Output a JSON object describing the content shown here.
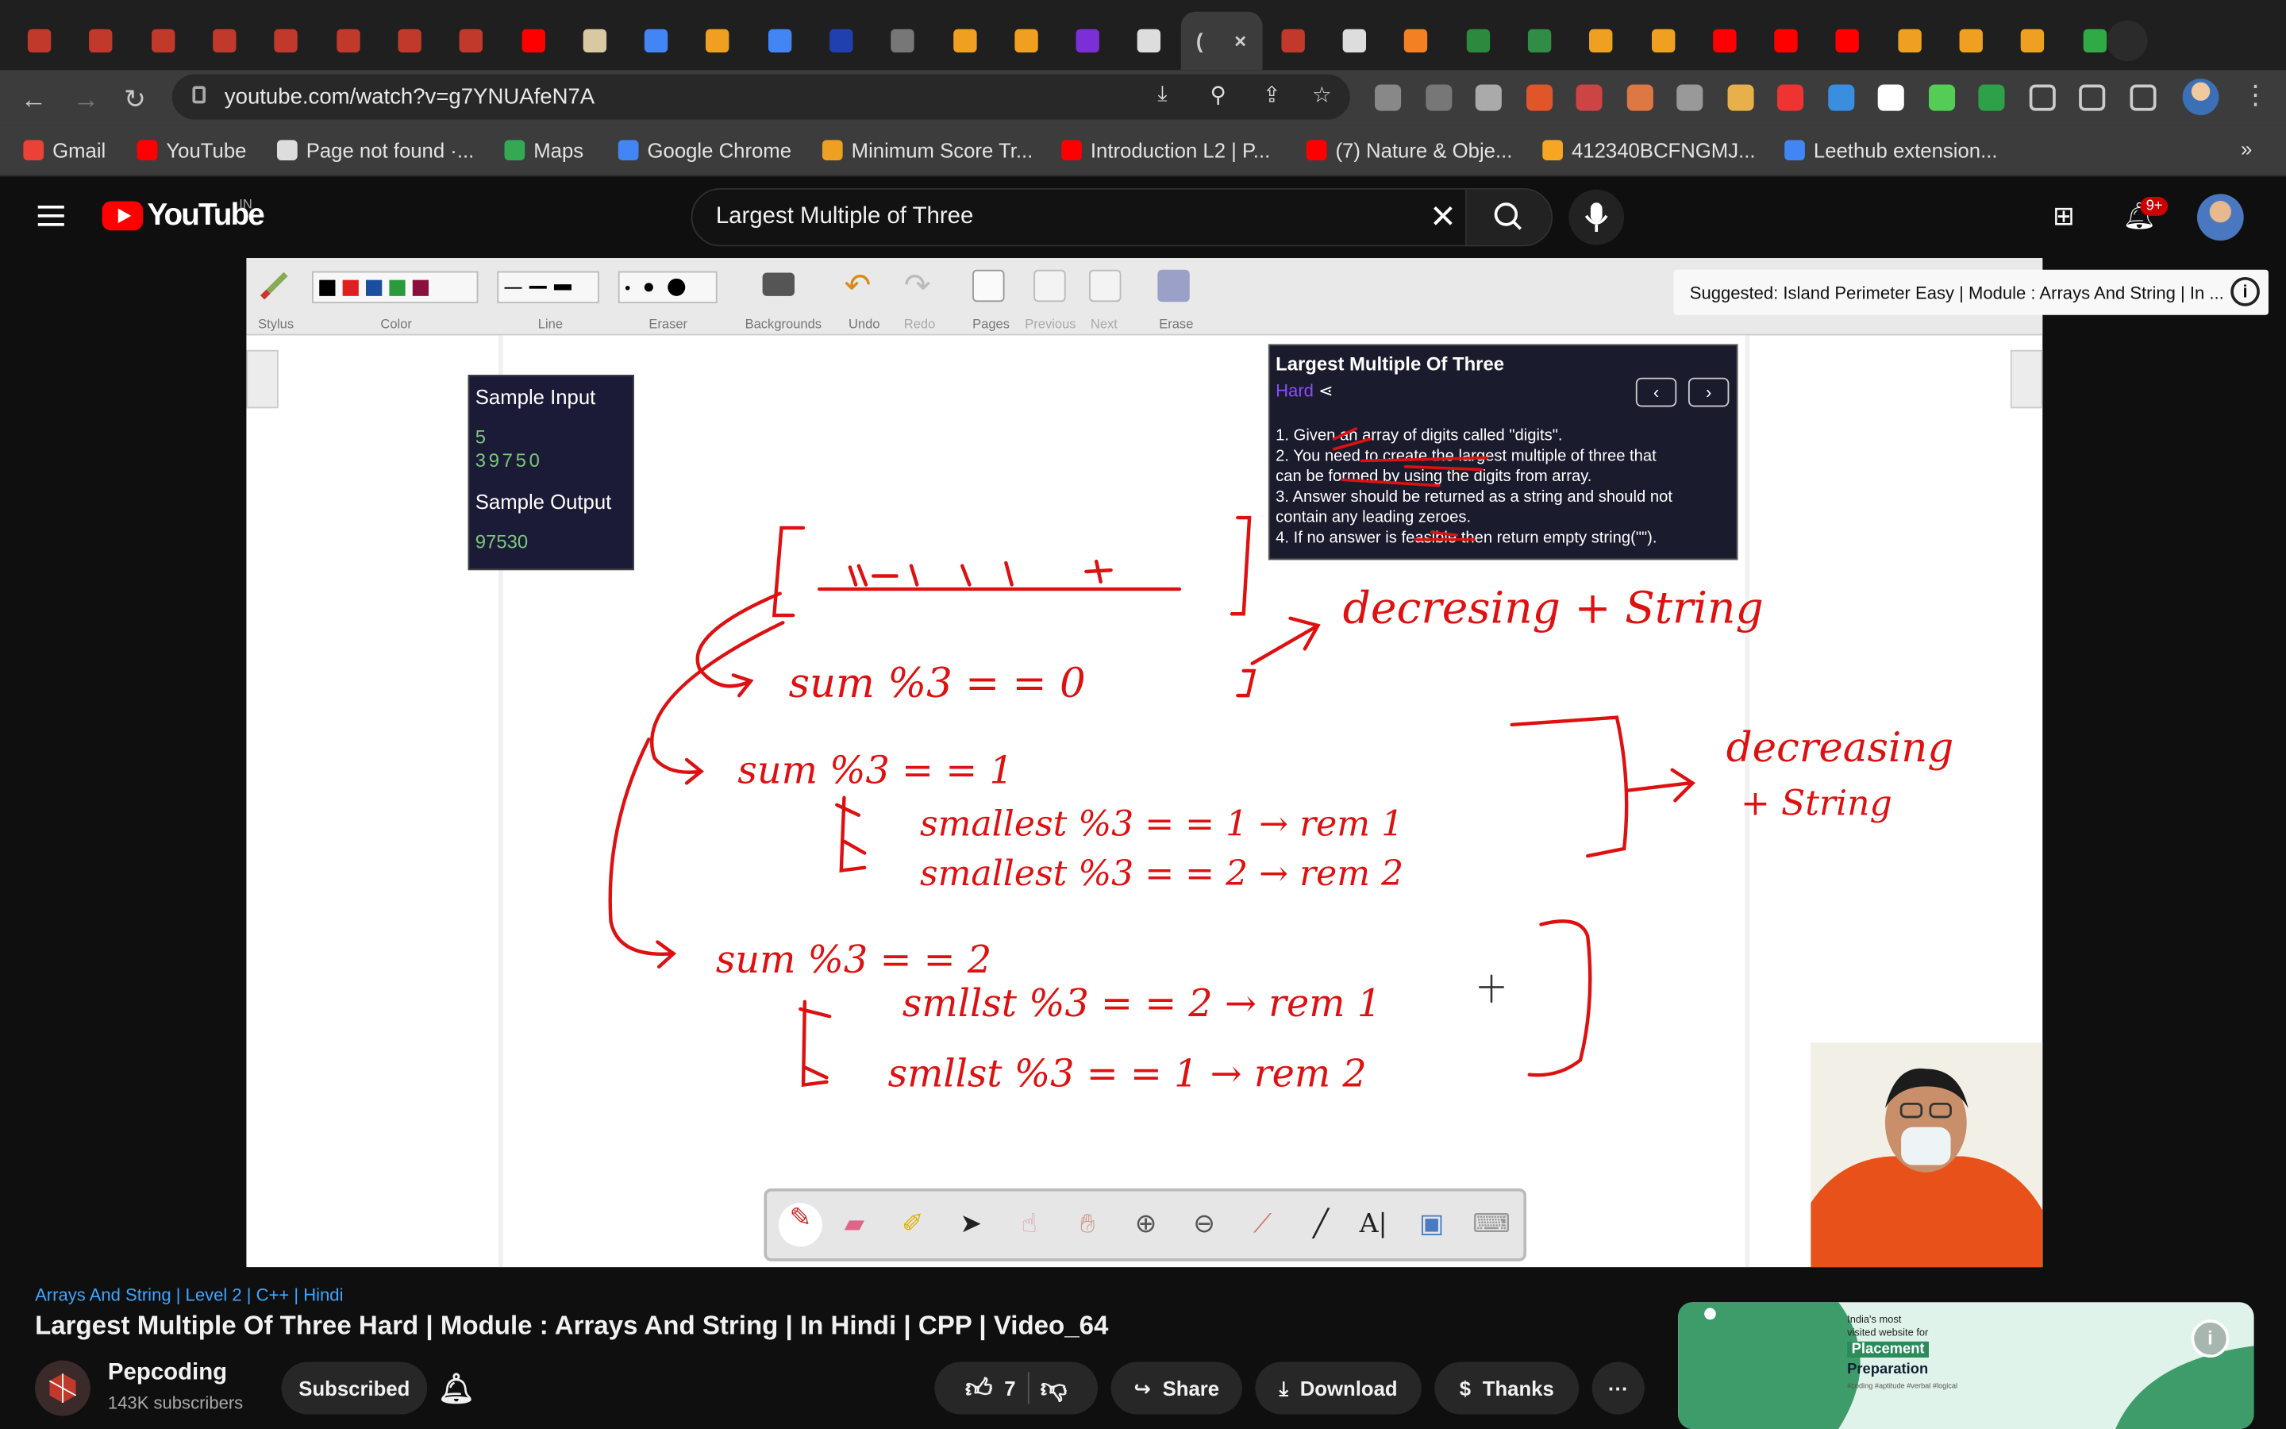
{
  "browser": {
    "tabs": [
      {
        "icon": "pepcoding-icon",
        "color": "#c0392b"
      },
      {
        "icon": "pepcoding-icon",
        "color": "#c0392b"
      },
      {
        "icon": "pepcoding-icon",
        "color": "#c0392b"
      },
      {
        "icon": "pepcoding-icon",
        "color": "#c0392b"
      },
      {
        "icon": "pepcoding-icon",
        "color": "#c0392b"
      },
      {
        "icon": "pepcoding-icon",
        "color": "#c0392b"
      },
      {
        "icon": "pepcoding-icon",
        "color": "#c0392b"
      },
      {
        "icon": "pepcoding-icon",
        "color": "#c0392b"
      },
      {
        "icon": "youtube-icon",
        "color": "#ff0000"
      },
      {
        "icon": "doc-icon",
        "color": "#d8c9a0"
      },
      {
        "icon": "google-icon",
        "color": "#4285f4"
      },
      {
        "icon": "leetcode-icon",
        "color": "#f0a020"
      },
      {
        "icon": "google-icon",
        "color": "#4285f4"
      },
      {
        "icon": "jssc-icon",
        "color": "#2040b0"
      },
      {
        "icon": "globe-icon",
        "color": "#777777"
      },
      {
        "icon": "leetcode-icon",
        "color": "#f0a020"
      },
      {
        "icon": "leetcode-icon",
        "color": "#f0a020"
      },
      {
        "icon": "purple-icon",
        "color": "#7b2fd4"
      },
      {
        "icon": "github-icon",
        "color": "#dddddd"
      }
    ],
    "tabs_after": [
      {
        "icon": "pepcoding-icon",
        "color": "#c0392b"
      },
      {
        "icon": "terminal-icon",
        "color": "#dddddd"
      },
      {
        "icon": "stack-overflow-icon",
        "color": "#f48024"
      },
      {
        "icon": "w-icon",
        "color": "#2c8a3c"
      },
      {
        "icon": "gfg-icon",
        "color": "#2f8d46"
      },
      {
        "icon": "leetcode-icon",
        "color": "#f0a020"
      },
      {
        "icon": "leetcode-icon",
        "color": "#f0a020"
      },
      {
        "icon": "youtube-icon",
        "color": "#ff0000"
      },
      {
        "icon": "youtube-icon",
        "color": "#ff0000"
      },
      {
        "icon": "youtube-icon",
        "color": "#ff0000"
      },
      {
        "icon": "leetcode-icon",
        "color": "#f0a020"
      },
      {
        "icon": "leetcode-icon",
        "color": "#f0a020"
      },
      {
        "icon": "leetcode-icon",
        "color": "#f0a020"
      },
      {
        "icon": "b-icon",
        "color": "#2faa44"
      }
    ],
    "active_tab": {
      "label": "(",
      "close": "×"
    },
    "url": "youtube.com/watch?v=g7YNUAfeN7A",
    "bookmarks": [
      {
        "label": "Gmail",
        "color": "#ea4335"
      },
      {
        "label": "YouTube",
        "color": "#ff0000"
      },
      {
        "label": "Page not found ·...",
        "color": "#dddddd"
      },
      {
        "label": "Maps",
        "color": "#34a853"
      },
      {
        "label": "Google Chrome",
        "color": "#4285f4"
      },
      {
        "label": "Minimum Score Tr...",
        "color": "#f0a020"
      },
      {
        "label": "Introduction L2 | P...",
        "color": "#ff0000"
      },
      {
        "label": "(7) Nature & Obje...",
        "color": "#ff0000"
      },
      {
        "label": "412340BCFNGMJ...",
        "color": "#f5a623"
      },
      {
        "label": "Leethub extension...",
        "color": "#4285f4"
      }
    ],
    "more": "»"
  },
  "youtube": {
    "logo_text": "YouTube",
    "region": "IN",
    "search_value": "Largest Multiple of Three",
    "notif_count": "9+"
  },
  "video": {
    "toolbar": {
      "groups": [
        "Stylus",
        "Color",
        "Line",
        "Eraser",
        "Backgrounds",
        "Undo",
        "Redo",
        "Pages",
        "Previous",
        "Next",
        "Erase"
      ],
      "colors": [
        "#000000",
        "#e02020",
        "#1a4fa0",
        "#2a9a3a",
        "#8a1040"
      ]
    },
    "suggested": "Suggested: Island Perimeter Easy | Module : Arrays And String | In ...",
    "sample": {
      "input_label": "Sample Input",
      "n": "5",
      "digits": "39750",
      "output_label": "Sample Output",
      "output": "97530"
    },
    "problem": {
      "title": "Largest Multiple Of Three",
      "difficulty": "Hard",
      "lines": [
        "1. Given an array of digits called \"digits\".",
        "2. You need to create the largest multiple of three that",
        "can be formed by using the digits from array.",
        "3. Answer should be returned as a string and should not",
        "contain any leading zeroes.",
        "4. If no answer is feasible then return empty string(\"\")."
      ]
    }
  },
  "meta": {
    "category": "Arrays And String | Level 2 | C++ | Hindi",
    "title": "Largest Multiple Of Three Hard | Module : Arrays And String | In Hindi | CPP | Video_64",
    "channel": "Pepcoding",
    "subscribers": "143K subscribers",
    "subscribed": "Subscribed",
    "likes": "7",
    "share": "Share",
    "download": "Download",
    "thanks": "Thanks",
    "more": "···"
  },
  "ad": {
    "line1": "India's most",
    "line2": "visited website for",
    "highlight": "Placement",
    "line3": "Preparation",
    "tags": "#coding  #aptitude  #verbal  #logical"
  }
}
